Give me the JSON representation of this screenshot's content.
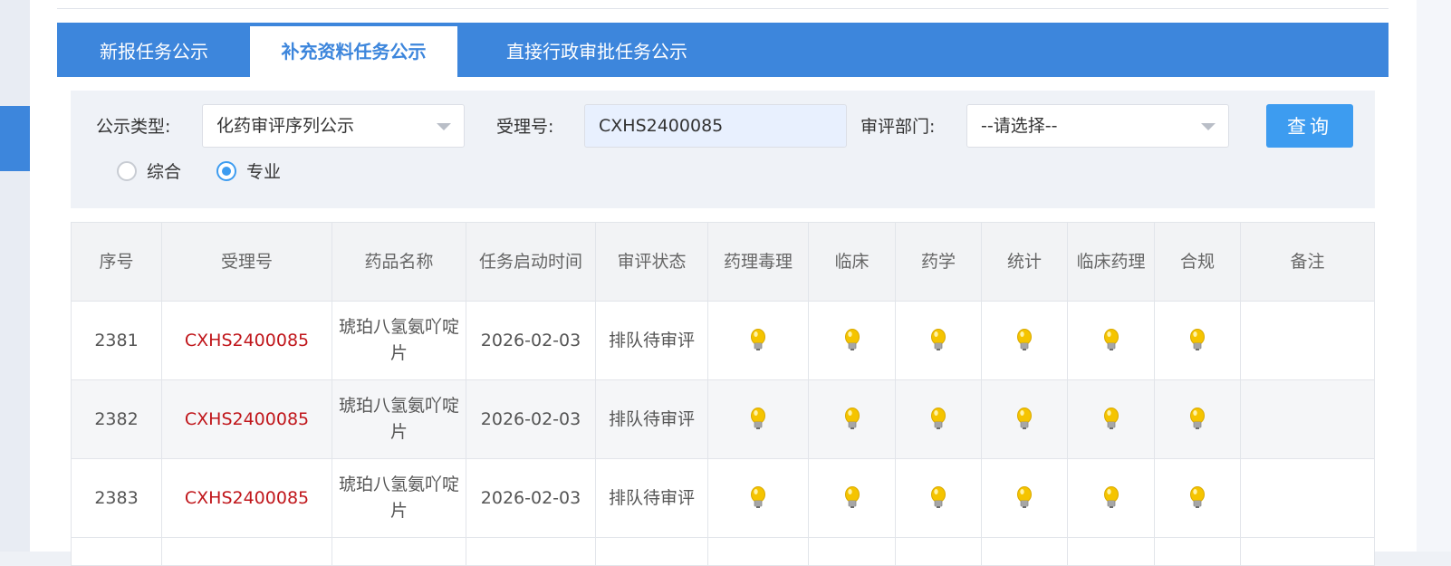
{
  "tabs": [
    {
      "label": "新报任务公示"
    },
    {
      "label": "补充资料任务公示"
    },
    {
      "label": "直接行政审批任务公示"
    }
  ],
  "filter": {
    "type_label": "公示类型:",
    "type_value": "化药审评序列公示",
    "accept_label": "受理号:",
    "accept_value": "CXHS2400085",
    "dept_label": "审评部门:",
    "dept_value": "--请选择--",
    "query_label": "查询",
    "radio_general": "综合",
    "radio_special": "专业",
    "radio_selected": "专业"
  },
  "table": {
    "columns": [
      "序号",
      "受理号",
      "药品名称",
      "任务启动时间",
      "审评状态",
      "药理毒理",
      "临床",
      "药学",
      "统计",
      "临床药理",
      "合规",
      "备注"
    ],
    "rows": [
      {
        "seq": "2381",
        "accept_no": "CXHS2400085",
        "drug": "琥珀八氢氨吖啶片",
        "start": "2026-02-03",
        "status": "排队待审评",
        "remark": ""
      },
      {
        "seq": "2382",
        "accept_no": "CXHS2400085",
        "drug": "琥珀八氢氨吖啶片",
        "start": "2026-02-03",
        "status": "排队待审评",
        "remark": ""
      },
      {
        "seq": "2383",
        "accept_no": "CXHS2400085",
        "drug": "琥珀八氢氨吖啶片",
        "start": "2026-02-03",
        "status": "排队待审评",
        "remark": ""
      }
    ]
  },
  "icons": {
    "review_discipline": "lightbulb-icon"
  },
  "colors": {
    "accent": "#3d86dc",
    "button": "#3d9cf0",
    "link": "#c0161b",
    "bulb": "#f5c400"
  }
}
